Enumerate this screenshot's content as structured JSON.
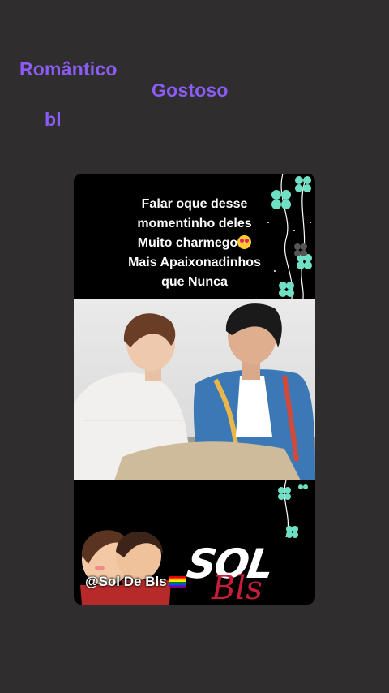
{
  "tags": [
    "Romântico",
    "Gostoso",
    "bl"
  ],
  "post": {
    "caption_lines": [
      "Falar oque desse",
      "momentinho deles",
      "Muito charmego",
      "Mais Apaixonadinhos",
      "que Nunca"
    ],
    "caption_emoji": "heart-eyes-icon",
    "handle": "@Sol De Bls",
    "handle_flag": "rainbow-flag-icon",
    "logo_main": "SOL",
    "logo_sub": "Bls"
  },
  "colors": {
    "background": "#2f2d2e",
    "tag_purple": "#8b5cf6",
    "card": "#000000",
    "clover": "#6fe0c4",
    "logo_red": "#c81d3a"
  }
}
